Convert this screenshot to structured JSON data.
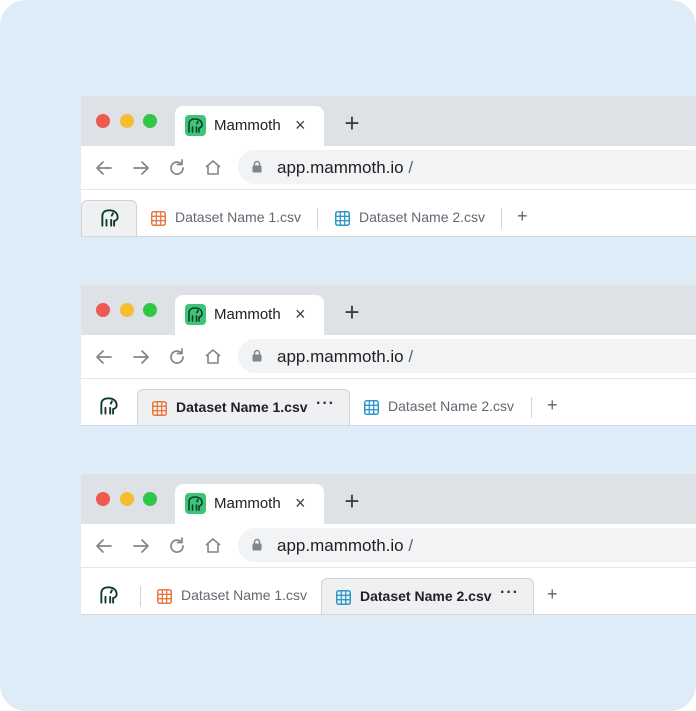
{
  "colors": {
    "background": "#deecf8",
    "csv_orange": "#e8773e",
    "csv_blue": "#2e97c8",
    "brand_green": "#3ec476"
  },
  "window_controls": [
    "close",
    "minimize",
    "maximize"
  ],
  "browser_windows": [
    {
      "chrome_tab": {
        "title": "Mammoth",
        "close": "×",
        "favicon": "mammoth-logo-icon"
      },
      "new_tab": "+",
      "url": {
        "host": "app.mammoth.io",
        "path": "/"
      },
      "app_tabs": {
        "active": "home",
        "items": [
          {
            "label": "Dataset Name 1.csv",
            "icon": "orange-grid-icon",
            "more": ""
          },
          {
            "label": "Dataset Name 2.csv",
            "icon": "blue-grid-icon",
            "more": ""
          }
        ],
        "add": "+"
      }
    },
    {
      "chrome_tab": {
        "title": "Mammoth",
        "close": "×",
        "favicon": "mammoth-logo-icon"
      },
      "new_tab": "+",
      "url": {
        "host": "app.mammoth.io",
        "path": "/"
      },
      "app_tabs": {
        "active": "Dataset Name 1.csv",
        "items": [
          {
            "label": "Dataset Name 1.csv",
            "icon": "orange-grid-icon",
            "more": "···"
          },
          {
            "label": "Dataset Name 2.csv",
            "icon": "blue-grid-icon",
            "more": ""
          }
        ],
        "add": "+"
      }
    },
    {
      "chrome_tab": {
        "title": "Mammoth",
        "close": "×",
        "favicon": "mammoth-logo-icon"
      },
      "new_tab": "+",
      "url": {
        "host": "app.mammoth.io",
        "path": "/"
      },
      "app_tabs": {
        "active": "Dataset Name 2.csv",
        "items": [
          {
            "label": "Dataset Name 1.csv",
            "icon": "orange-grid-icon",
            "more": ""
          },
          {
            "label": "Dataset Name 2.csv",
            "icon": "blue-grid-icon",
            "more": "···"
          }
        ],
        "add": "+"
      }
    }
  ]
}
